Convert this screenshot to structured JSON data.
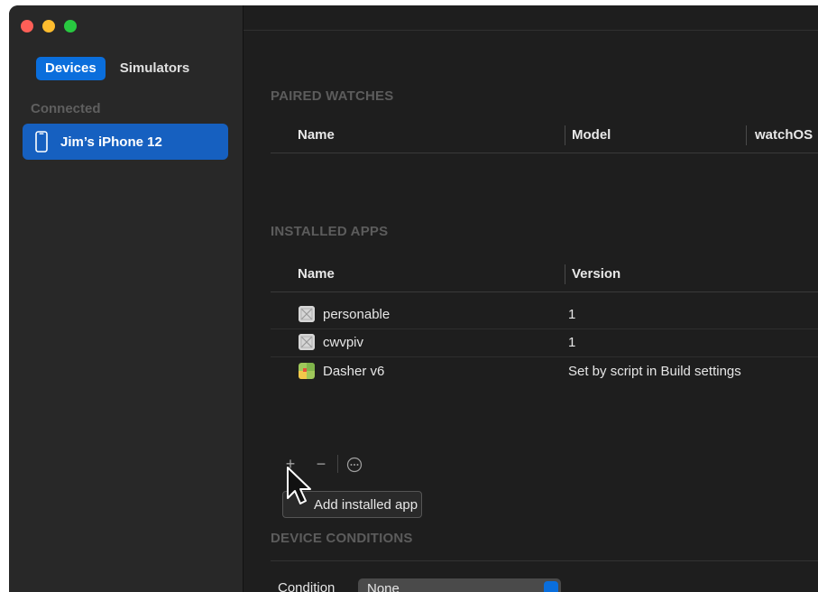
{
  "sidebar": {
    "tabs": [
      {
        "label": "Devices",
        "active": true
      },
      {
        "label": "Simulators",
        "active": false
      }
    ],
    "section_label": "Connected",
    "device": {
      "label": "Jim’s iPhone 12",
      "icon": "iphone-icon"
    }
  },
  "paired_watches": {
    "title": "PAIRED WATCHES",
    "columns": [
      "Name",
      "Model",
      "watchOS"
    ]
  },
  "installed_apps": {
    "title": "INSTALLED APPS",
    "columns": [
      "Name",
      "Version"
    ],
    "rows": [
      {
        "name": "personable",
        "version": "1",
        "icon": "placeholder-app-icon"
      },
      {
        "name": "cwvpiv",
        "version": "1",
        "icon": "placeholder-app-icon"
      },
      {
        "name": "Dasher v6",
        "version": "Set by script in Build settings",
        "icon": "dasher-app-icon"
      }
    ],
    "actions": {
      "add": "+",
      "remove": "−",
      "more": "⋯"
    },
    "tooltip": "Add installed app"
  },
  "device_conditions": {
    "title": "DEVICE CONDITIONS",
    "condition_label": "Condition",
    "condition_value": "None"
  },
  "colors": {
    "accent": "#0a6edc",
    "selection": "#1660c0",
    "sidebar_bg": "#282828",
    "main_bg": "#1e1e1e"
  }
}
